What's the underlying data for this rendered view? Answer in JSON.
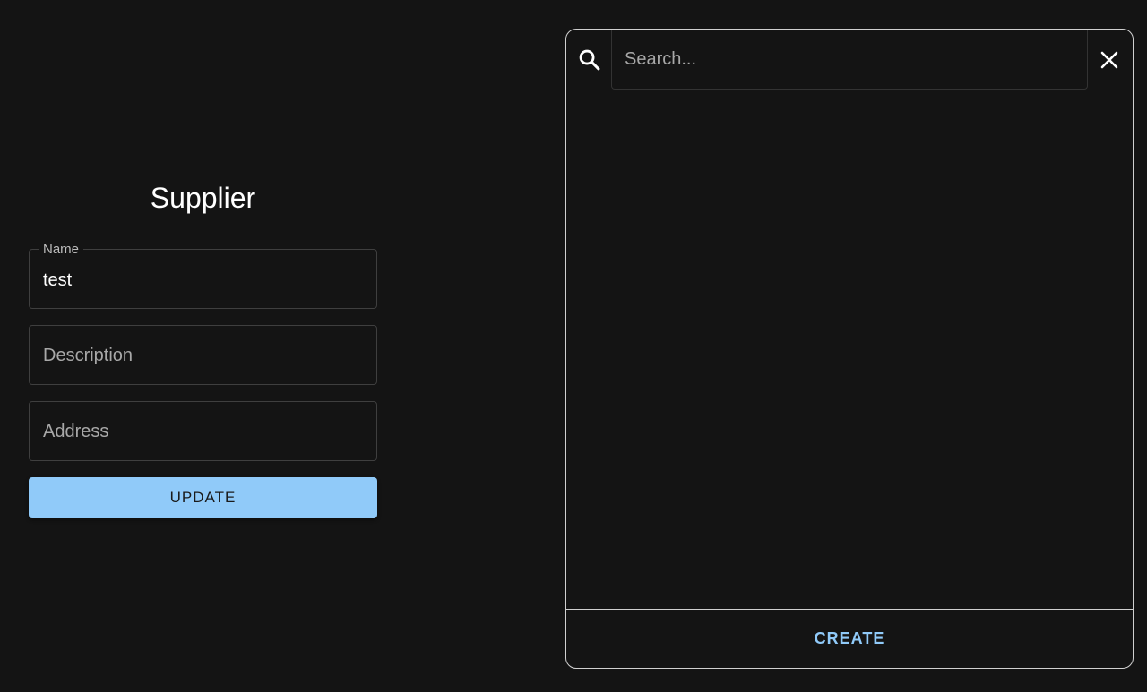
{
  "form": {
    "title": "Supplier",
    "fields": [
      {
        "label": "Name",
        "value": "test",
        "placeholder": "Name"
      },
      {
        "label": "Description",
        "value": "",
        "placeholder": "Description"
      },
      {
        "label": "Address",
        "value": "",
        "placeholder": "Address"
      }
    ],
    "update_label": "UPDATE"
  },
  "search_dialog": {
    "placeholder": "Search...",
    "query": "",
    "search_icon": "search-icon",
    "close_icon": "close-icon",
    "create_label": "CREATE"
  },
  "colors": {
    "background": "#141414",
    "accent": "#90caf9",
    "border": "#d0d0d0"
  }
}
